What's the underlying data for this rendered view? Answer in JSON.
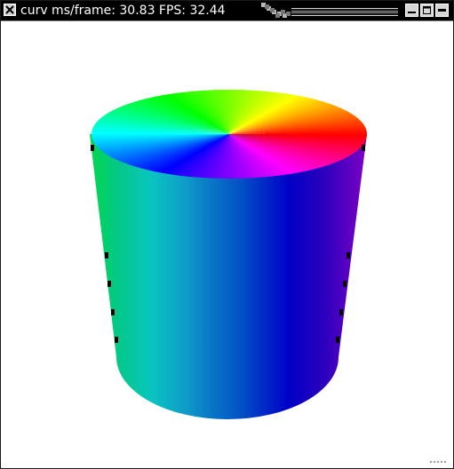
{
  "window": {
    "title": "curv ms/frame: 30.83 FPS: 32.44",
    "icons": {
      "menu": "close-x-icon",
      "minimize": "minimize-icon",
      "maximize": "maximize-icon",
      "close": "close-icon"
    }
  },
  "scene": {
    "object": "cylinder",
    "background": "#ffffff",
    "coloring": "hue-by-angle",
    "edge_marks": "#000000"
  }
}
